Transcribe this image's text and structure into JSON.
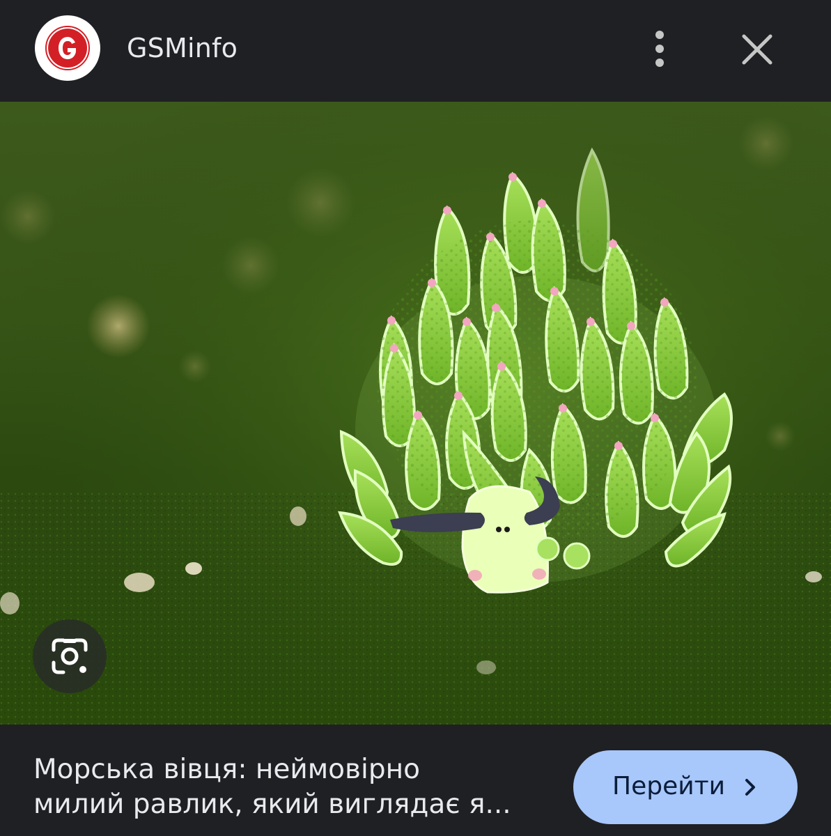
{
  "header": {
    "site_name": "GSMinfo",
    "logo_letter": "G",
    "more_icon": "more-vert-icon",
    "close_icon": "close-icon"
  },
  "image": {
    "subject": "sea slug on green algae",
    "lens_icon": "google-lens-icon"
  },
  "footer": {
    "caption_line1": "Морська вівця: неймовірно",
    "caption_line2": "милий равлик, який виглядає я...",
    "visit_label": "Перейти",
    "visit_icon": "chevron-right-icon"
  },
  "colors": {
    "background": "#1f2023",
    "text": "#e8eaed",
    "button": "#a8c7fa",
    "button_text": "#0b1d3a",
    "logo_red": "#d32026"
  }
}
